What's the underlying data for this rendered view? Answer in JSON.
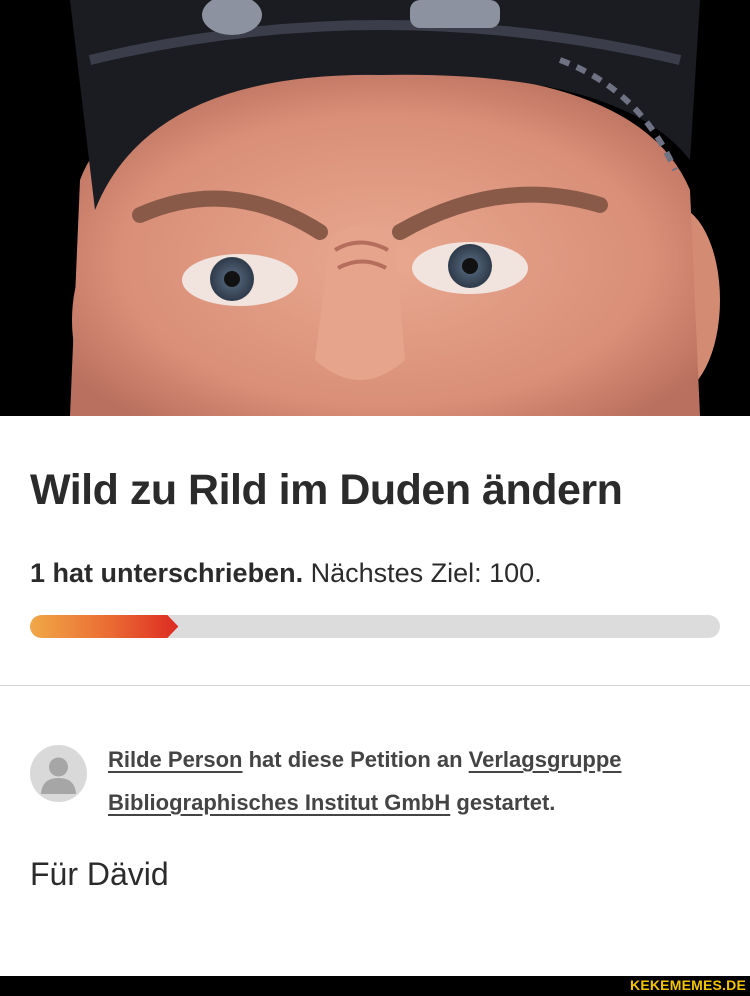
{
  "petition": {
    "title": "Wild zu Rild im Duden ändern",
    "signatures_bold": "1 hat unterschrieben.",
    "next_goal": "Nächstes Ziel: 100.",
    "progress_fraction": 0.215
  },
  "starter": {
    "person": "Rilde Person",
    "text_mid": "hat diese Petition an",
    "recipient": "Verlagsgruppe Bibliographisches Institut GmbH",
    "text_end": "gestartet."
  },
  "body": {
    "text": "Für Dävid"
  },
  "watermark": "KEKEMEMES.DE",
  "colors": {
    "progress_start": "#f0a848",
    "progress_end": "#dd2b23",
    "track": "#dcdcdc",
    "watermark": "#f2c400"
  }
}
